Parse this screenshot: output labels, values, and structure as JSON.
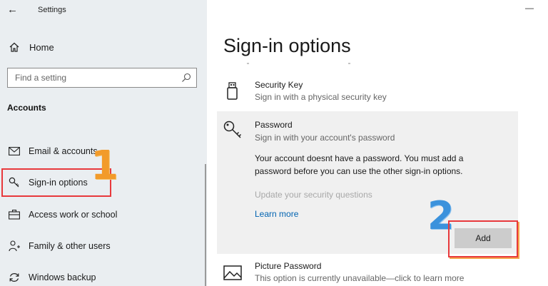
{
  "window": {
    "title": "Settings",
    "minimize_glyph": "—"
  },
  "sidebar": {
    "home_label": "Home",
    "search": {
      "placeholder": "Find a setting"
    },
    "section": "Accounts",
    "items": [
      {
        "label": "Email & accounts",
        "icon": "mail-icon"
      },
      {
        "label": "Sign-in options",
        "icon": "key-icon",
        "active": true
      },
      {
        "label": "Access work or school",
        "icon": "briefcase-icon"
      },
      {
        "label": "Family & other users",
        "icon": "person-add-icon"
      },
      {
        "label": "Windows backup",
        "icon": "sync-icon"
      }
    ]
  },
  "main": {
    "title": "Sign-in options",
    "options": {
      "security_key": {
        "title": "Security Key",
        "desc": "Sign in with a physical security key"
      },
      "password": {
        "title": "Password",
        "desc": "Sign in with your account's password",
        "message": "Your account doesnt have a password. You must add a password before you can use the other sign-in options.",
        "update_link": "Update your security questions",
        "learn_more": "Learn more",
        "add_button": "Add"
      },
      "picture_password": {
        "title": "Picture Password",
        "desc": "This option is currently unavailable—click to learn more"
      }
    }
  },
  "annotations": {
    "step1": "1",
    "step2": "2"
  },
  "colors": {
    "highlight_border": "#e8393c",
    "step1": "#f29b2a",
    "step2": "#3b92dc",
    "link": "#0063b1",
    "sidebar_bg": "#eaeef1"
  }
}
